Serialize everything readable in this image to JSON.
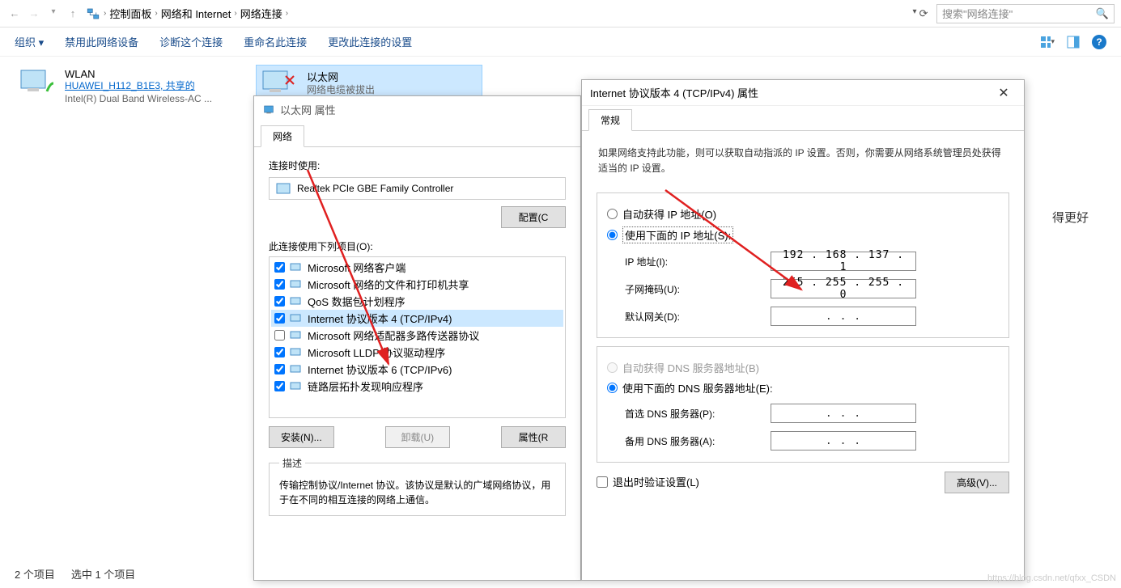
{
  "breadcrumb": {
    "l1": "控制面板",
    "l2": "网络和 Internet",
    "l3": "网络连接"
  },
  "search": {
    "placeholder": "搜索\"网络连接\""
  },
  "toolbar": {
    "organize": "组织 ▾",
    "disable": "禁用此网络设备",
    "diagnose": "诊断这个连接",
    "rename": "重命名此连接",
    "change": "更改此连接的设置"
  },
  "connections": {
    "wlan": {
      "title": "WLAN",
      "line1": "HUAWEI_H112_B1E3, 共享的",
      "line2": "Intel(R) Dual Band Wireless-AC ..."
    },
    "eth": {
      "title": "以太网",
      "line1": "网络电缆被拔出"
    }
  },
  "status": {
    "items": "2 个项目",
    "selected": "选中 1 个项目"
  },
  "dlg_eth": {
    "title": "以太网 属性",
    "tab": "网络",
    "connect_using": "连接时使用:",
    "adapter": "Realtek PCIe GBE Family Controller",
    "configure": "配置(C",
    "items_label": "此连接使用下列项目(O):",
    "items": [
      {
        "checked": true,
        "label": "Microsoft 网络客户端"
      },
      {
        "checked": true,
        "label": "Microsoft 网络的文件和打印机共享"
      },
      {
        "checked": true,
        "label": "QoS 数据包计划程序"
      },
      {
        "checked": true,
        "label": "Internet 协议版本 4 (TCP/IPv4)",
        "selected": true
      },
      {
        "checked": false,
        "label": "Microsoft 网络适配器多路传送器协议"
      },
      {
        "checked": true,
        "label": "Microsoft LLDP 协议驱动程序"
      },
      {
        "checked": true,
        "label": "Internet 协议版本 6 (TCP/IPv6)"
      },
      {
        "checked": true,
        "label": "链路层拓扑发现响应程序"
      }
    ],
    "install": "安装(N)...",
    "uninstall": "卸载(U)",
    "properties": "属性(R",
    "desc_legend": "描述",
    "desc_text": "传输控制协议/Internet 协议。该协议是默认的广域网络协议，用于在不同的相互连接的网络上通信。"
  },
  "dlg_ipv4": {
    "title": "Internet 协议版本 4 (TCP/IPv4) 属性",
    "tab": "常规",
    "intro": "如果网络支持此功能，则可以获取自动指派的 IP 设置。否则，你需要从网络系统管理员处获得适当的 IP 设置。",
    "radio_auto_ip": "自动获得 IP 地址(O)",
    "radio_manual_ip": "使用下面的 IP 地址(S):",
    "ip_label": "IP 地址(I):",
    "ip_value": "192 . 168 . 137 .  1",
    "mask_label": "子网掩码(U):",
    "mask_value": "255 . 255 . 255 .  0",
    "gw_label": "默认网关(D):",
    "gw_value": " .       .       . ",
    "radio_auto_dns": "自动获得 DNS 服务器地址(B)",
    "radio_manual_dns": "使用下面的 DNS 服务器地址(E):",
    "dns1_label": "首选 DNS 服务器(P):",
    "dns1_value": " .       .       . ",
    "dns2_label": "备用 DNS 服务器(A):",
    "dns2_value": " .       .       . ",
    "validate": "退出时验证设置(L)",
    "advanced": "高级(V)..."
  },
  "side_text": "得更好",
  "watermark": "https://blog.csdn.net/qfxx_CSDN"
}
